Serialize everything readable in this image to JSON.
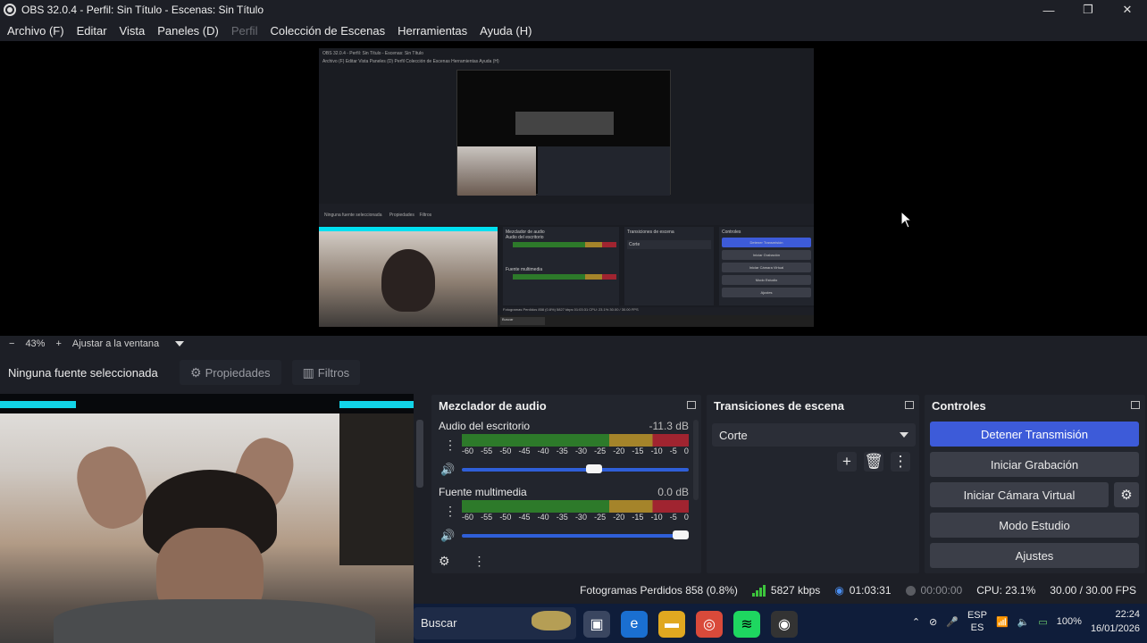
{
  "window": {
    "title": "OBS 32.0.4 - Perfil: Sin Título - Escenas: Sin Título",
    "minimize": "—",
    "maximize": "❐",
    "close": "✕"
  },
  "menu": {
    "items": [
      "Archivo (F)",
      "Editar",
      "Vista",
      "Paneles (D)",
      "Perfil",
      "Colección de Escenas",
      "Herramientas",
      "Ayuda (H)"
    ],
    "disabled_index": 4
  },
  "preview": {
    "inner_title": "OBS 32.0.4 - Perfil: Sin Título - Escenas: Sin Título",
    "inner_menu": "Archivo (F)   Editar   Vista   Paneles (D)   Perfil   Colección de Escenas   Herramientas   Ayuda (H)",
    "inner_nosource": "Ninguna fuente seleccionada",
    "inner_props": "Propiedades",
    "inner_filters": "Filtros",
    "inner_mixer_title": "Mezclador de audio",
    "inner_ch1": "Audio del escritorio",
    "inner_ch2": "Fuente multimedia",
    "inner_trans_title": "Transiciones de escena",
    "inner_trans_value": "Corte",
    "inner_ctrl_title": "Controles",
    "inner_ctrl_buttons": [
      "Detener Transmisión",
      "Iniciar Grabación",
      "Iniciar Cámara Virtual",
      "Modo Estudio",
      "Ajustes"
    ],
    "inner_status": "Fotogramas Perdidos 858 (0.8%)   5827 kbps   01:03:31   CPU: 23.1%   30.00 / 30.00 FPS",
    "inner_search": "Buscar"
  },
  "zoom": {
    "minus": "−",
    "level": "43%",
    "plus": "+",
    "fit": "Ajustar a la ventana"
  },
  "sourcebar": {
    "no_source": "Ninguna fuente seleccionada",
    "properties": "Propiedades",
    "filters": "Filtros"
  },
  "mixer": {
    "title": "Mezclador de audio",
    "ticks": [
      "-60",
      "-55",
      "-50",
      "-45",
      "-40",
      "-35",
      "-30",
      "-25",
      "-20",
      "-15",
      "-10",
      "-5",
      "0"
    ],
    "channels": [
      {
        "name": "Audio del escritorio",
        "db": "-11.3 dB",
        "volume": 0.62
      },
      {
        "name": "Fuente multimedia",
        "db": "0.0 dB",
        "volume": 1.0
      }
    ]
  },
  "transitions": {
    "title": "Transiciones de escena",
    "selected": "Corte"
  },
  "controls": {
    "title": "Controles",
    "stop_stream": "Detener Transmisión",
    "start_recording": "Iniciar Grabación",
    "start_virtual_cam": "Iniciar Cámara Virtual",
    "studio_mode": "Modo Estudio",
    "settings": "Ajustes"
  },
  "status": {
    "dropped_frames": "Fotogramas Perdidos 858 (0.8%)",
    "bitrate": "5827 kbps",
    "stream_time": "01:03:31",
    "rec_time": "00:00:00",
    "cpu": "CPU: 23.1%",
    "fps": "30.00 / 30.00 FPS"
  },
  "taskbar": {
    "search": "Buscar",
    "lang_top": "ESP",
    "lang_bottom": "ES",
    "battery": "100%",
    "time": "22:24",
    "date": "16/01/2026"
  },
  "colors": {
    "accent": "#3d5bd9",
    "panel": "#22252d",
    "background": "#1d1f26",
    "meter_green": "#2d7a2a",
    "meter_yellow": "#a5842a",
    "meter_red": "#a02430",
    "cyan": "#12d4e8"
  },
  "icons": [
    "obs-logo-icon",
    "gear-icon",
    "filter-icon",
    "undock-icon",
    "speaker-icon",
    "kebab-icon",
    "plus-icon",
    "trash-icon",
    "signal-icon",
    "stream-icon",
    "record-icon",
    "wifi-icon",
    "volume-icon",
    "battery-icon"
  ]
}
